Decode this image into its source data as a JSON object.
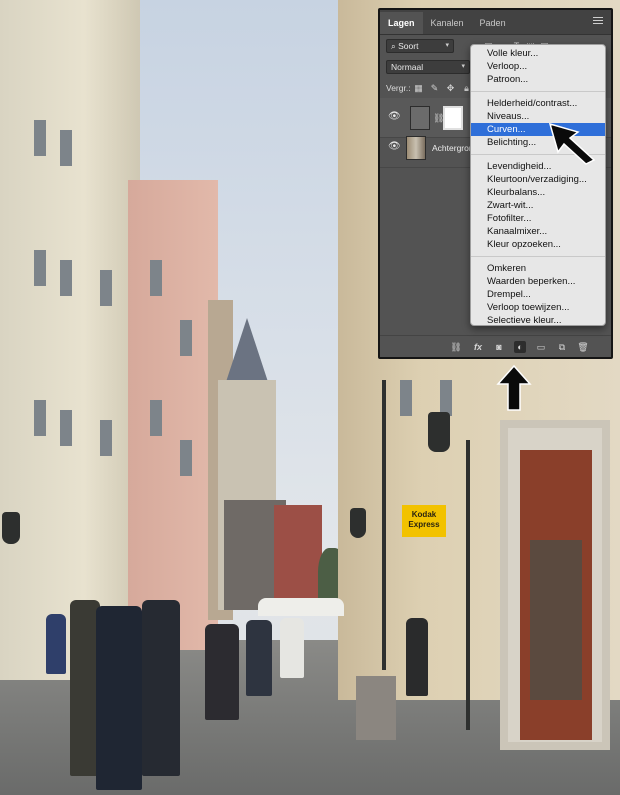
{
  "panel": {
    "tabs": [
      {
        "label": "Lagen",
        "active": true
      },
      {
        "label": "Kanalen",
        "active": false
      },
      {
        "label": "Paden",
        "active": false
      }
    ],
    "filter_label": "Soort",
    "blend_mode": "Normaal",
    "lock_label": "Vergr.:",
    "layers": [
      {
        "name": "",
        "type": "adjustment",
        "selected": true
      },
      {
        "name": "Achtergrond",
        "type": "image",
        "selected": false
      }
    ],
    "bottom_icons": [
      "link-icon",
      "fx-icon",
      "mask-icon",
      "adjustment-icon",
      "folder-icon",
      "new-layer-icon",
      "trash-icon"
    ],
    "fx_label": "fx"
  },
  "menu": {
    "group1": [
      "Volle kleur...",
      "Verloop...",
      "Patroon..."
    ],
    "group2": [
      "Helderheid/contrast...",
      "Niveaus...",
      "Curven...",
      "Belichting..."
    ],
    "group3": [
      "Levendigheid...",
      "Kleurtoon/verzadiging...",
      "Kleurbalans...",
      "Zwart-wit...",
      "Fotofilter...",
      "Kanaalmixer...",
      "Kleur opzoeken..."
    ],
    "group4": [
      "Omkeren",
      "Waarden beperken...",
      "Drempel...",
      "Verloop toewijzen...",
      "Selectieve kleur..."
    ],
    "highlighted": "Curven..."
  },
  "photo": {
    "sign": "Kodak Express"
  },
  "colors": {
    "panel_bg": "#535353",
    "menu_bg": "#e7e7e7",
    "highlight": "#2f6fd9"
  }
}
